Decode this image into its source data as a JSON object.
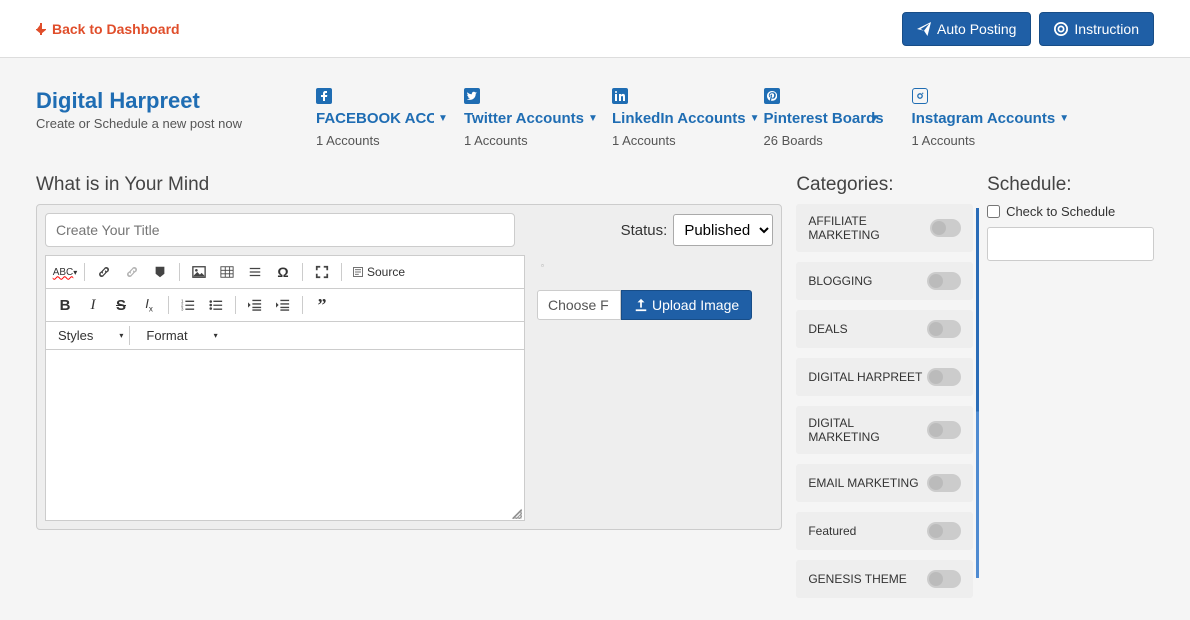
{
  "topbar": {
    "back_label": "Back to Dashboard",
    "auto_posting": "Auto Posting",
    "instruction": "Instruction"
  },
  "brand": {
    "title": "Digital Harpreet",
    "subtitle": "Create or Schedule a new post now"
  },
  "accounts": [
    {
      "label": "FACEBOOK ACCOUNT",
      "sub": "1 Accounts",
      "icon": "facebook",
      "caret": true
    },
    {
      "label": "Twitter Accounts",
      "sub": "1 Accounts",
      "icon": "twitter",
      "caret": true
    },
    {
      "label": "LinkedIn Accounts",
      "sub": "1 Accounts",
      "icon": "linkedin",
      "caret": true
    },
    {
      "label": "Pinterest Boards",
      "sub": "26 Boards",
      "icon": "pinterest",
      "caret": true
    },
    {
      "label": "Instagram Accounts",
      "sub": "1 Accounts",
      "icon": "instagram",
      "caret": true
    }
  ],
  "editor": {
    "section_title": "What is in Your Mind",
    "title_placeholder": "Create Your Title",
    "status_label": "Status:",
    "status_value": "Published",
    "source_label": "Source",
    "styles_label": "Styles",
    "format_label": "Format",
    "choose_file": "Choose F",
    "upload_label": "Upload Image"
  },
  "categories": {
    "title": "Categories:",
    "items": [
      "AFFILIATE MARKETING",
      "BLOGGING",
      "DEALS",
      "DIGITAL HARPREET",
      "DIGITAL MARKETING",
      "EMAIL MARKETING",
      "Featured",
      "GENESIS THEME"
    ]
  },
  "schedule": {
    "title": "Schedule:",
    "check_label": "Check to Schedule"
  }
}
